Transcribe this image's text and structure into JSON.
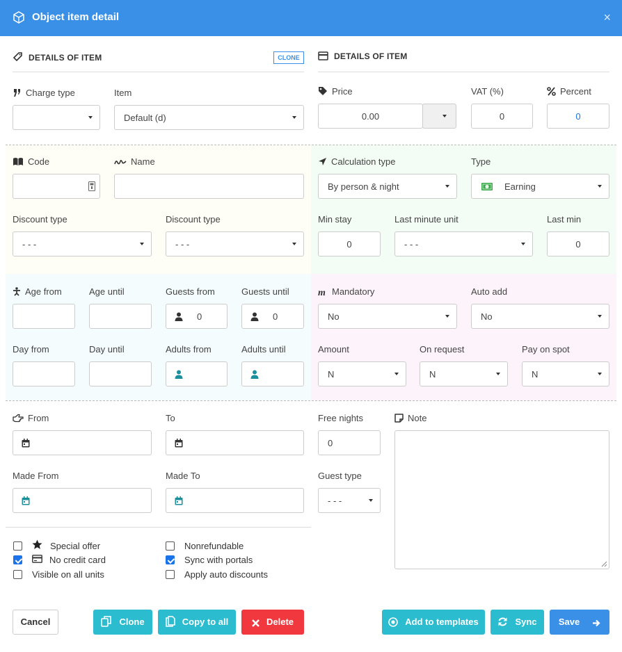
{
  "window": {
    "title": "Object item detail",
    "close": "×"
  },
  "left_header": {
    "title": "DETAILS OF ITEM",
    "clone_tag": "CLONE"
  },
  "right_header": {
    "title": "DETAILS OF ITEM"
  },
  "charge_type": {
    "label": "Charge type",
    "value": ""
  },
  "item": {
    "label": "Item",
    "value": "Default (d)"
  },
  "price": {
    "label": "Price",
    "value": "0.00"
  },
  "vat": {
    "label": "VAT (%)",
    "value": "0"
  },
  "percent": {
    "label": "Percent",
    "value": "0"
  },
  "code": {
    "label": "Code",
    "value": ""
  },
  "name": {
    "label": "Name",
    "value": ""
  },
  "calculation_type": {
    "label": "Calculation type",
    "value": "By person & night"
  },
  "type": {
    "label": "Type",
    "value": "Earning"
  },
  "discount_type_1": {
    "label": "Discount type",
    "value": "- - -"
  },
  "discount_type_2": {
    "label": "Discount type",
    "value": "- - -"
  },
  "min_stay": {
    "label": "Min stay",
    "value": "0"
  },
  "last_minute_unit": {
    "label": "Last minute unit",
    "value": "- - -"
  },
  "last_min": {
    "label": "Last min",
    "value": "0"
  },
  "age_from": {
    "label": "Age from",
    "value": ""
  },
  "age_until": {
    "label": "Age until",
    "value": ""
  },
  "guests_from": {
    "label": "Guests from",
    "value": "0"
  },
  "guests_until": {
    "label": "Guests until",
    "value": "0"
  },
  "mandatory": {
    "label": "Mandatory",
    "value": "No"
  },
  "auto_add": {
    "label": "Auto add",
    "value": "No"
  },
  "day_from": {
    "label": "Day from",
    "value": ""
  },
  "day_until": {
    "label": "Day until",
    "value": ""
  },
  "adults_from": {
    "label": "Adults from",
    "value": ""
  },
  "adults_until": {
    "label": "Adults until",
    "value": ""
  },
  "amount": {
    "label": "Amount",
    "value": "N"
  },
  "on_request": {
    "label": "On request",
    "value": "N"
  },
  "pay_on_spot": {
    "label": "Pay on spot",
    "value": "N"
  },
  "from": {
    "label": "From",
    "value": ""
  },
  "to": {
    "label": "To",
    "value": ""
  },
  "free_nights": {
    "label": "Free nights",
    "value": "0"
  },
  "note": {
    "label": "Note",
    "value": ""
  },
  "made_from": {
    "label": "Made From",
    "value": ""
  },
  "made_to": {
    "label": "Made To",
    "value": ""
  },
  "guest_type": {
    "label": "Guest type",
    "value": "- - -"
  },
  "checkboxes": {
    "special_offer": {
      "label": "Special offer",
      "checked": false
    },
    "no_credit_card": {
      "label": "No credit card",
      "checked": true
    },
    "visible_all_units": {
      "label": "Visible on all units",
      "checked": false
    },
    "nonrefundable": {
      "label": "Nonrefundable",
      "checked": false
    },
    "sync_portals": {
      "label": "Sync with portals",
      "checked": true
    },
    "apply_auto_discounts": {
      "label": "Apply auto discounts",
      "checked": false
    }
  },
  "buttons": {
    "cancel": "Cancel",
    "clone": "Clone",
    "copy_to_all": "Copy to all",
    "delete": "Delete",
    "add_templates": "Add to templates",
    "sync": "Sync",
    "save": "Save"
  },
  "colors": {
    "title_bar": "#3a90e6",
    "teal_button": "#2bbcd0",
    "delete_button": "#f0383e",
    "save_button": "#3a90e6",
    "band_yellow": "#fefef6",
    "band_green": "#f3fdf5",
    "band_cyan": "#f4fcfd",
    "band_pink": "#fdf3fb",
    "percent_value": "#1a73e8"
  }
}
